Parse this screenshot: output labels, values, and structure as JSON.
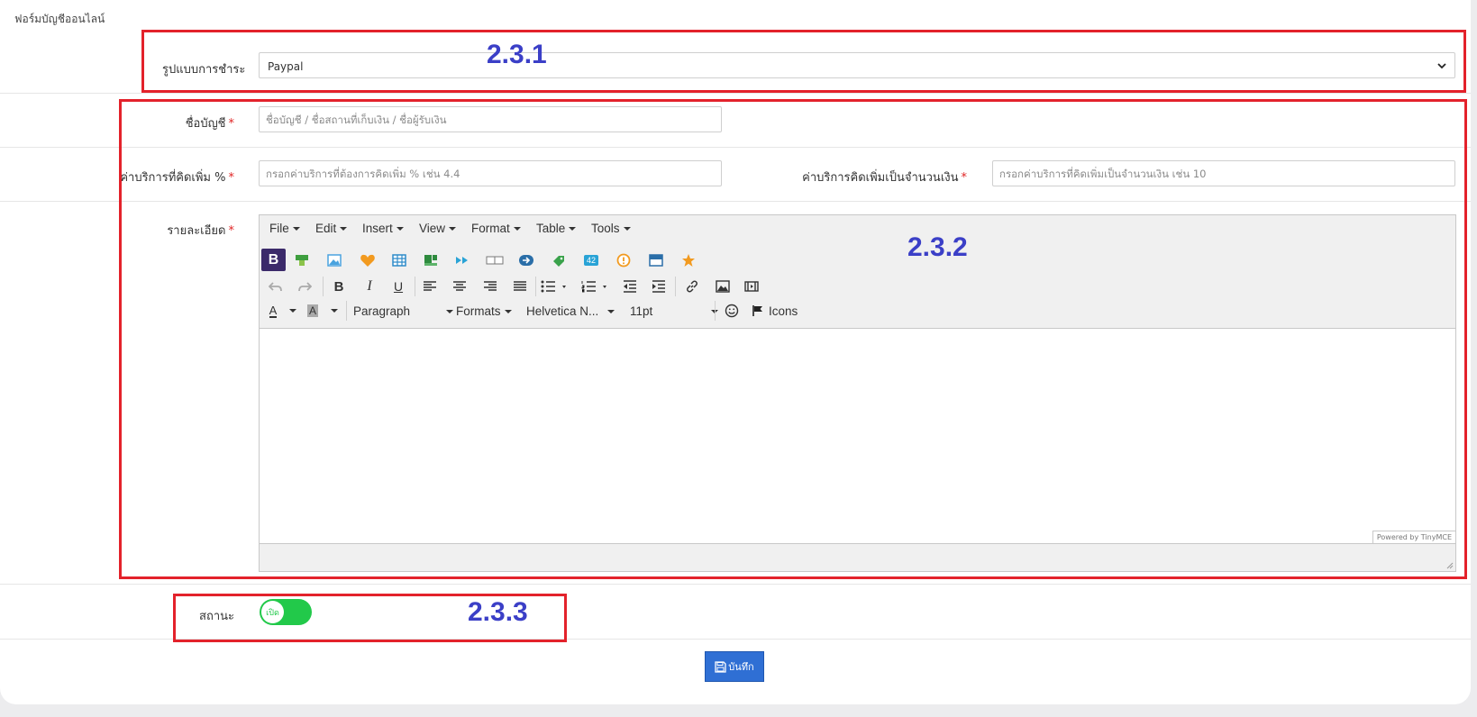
{
  "form": {
    "title": "ฟอร์มบัญชีออนไลน์",
    "payment_label": "รูปแบบการชำระ",
    "payment_value": "Paypal",
    "account_label": "ชื่อบัญชี",
    "account_placeholder": "ชื่อบัญชี / ชื่อสถานที่เก็บเงิน / ชื่อผู้รับเงิน",
    "fee_percent_label": "ค่าบริการที่คิดเพิ่ม %",
    "fee_percent_placeholder": "กรอกค่าบริการที่ต้องการคิดเพิ่ม % เช่น 4.4",
    "fee_amount_label": "ค่าบริการคิดเพิ่มเป็นจำนวนเงิน",
    "fee_amount_placeholder": "กรอกค่าบริการที่คิดเพิ่มเป็นจำนวนเงิน เช่น 10",
    "detail_label": "รายละเอียด",
    "required_mark": "*",
    "status_label": "สถานะ",
    "status_toggle_text": "เปิด",
    "save_label": "บันทึก"
  },
  "editor": {
    "menus": [
      "File",
      "Edit",
      "Insert",
      "View",
      "Format",
      "Table",
      "Tools"
    ],
    "paragraph": "Paragraph",
    "formats": "Formats",
    "font": "Helvetica N...",
    "size": "11pt",
    "icons_label": "Icons",
    "powered": "Powered by TinyMCE",
    "badge_42": "42",
    "badge_12": "1|2",
    "bold_letter": "B",
    "italic_letter": "I",
    "underline_letter": "U",
    "color_letter": "A"
  },
  "annotations": {
    "a1": "2.3.1",
    "a2": "2.3.2",
    "a3": "2.3.3"
  },
  "colors": {
    "annotation_box": "#e3222b",
    "annotation_text": "#3b3fc7",
    "toggle_on": "#22c94a",
    "save_button": "#2f6fd4"
  }
}
